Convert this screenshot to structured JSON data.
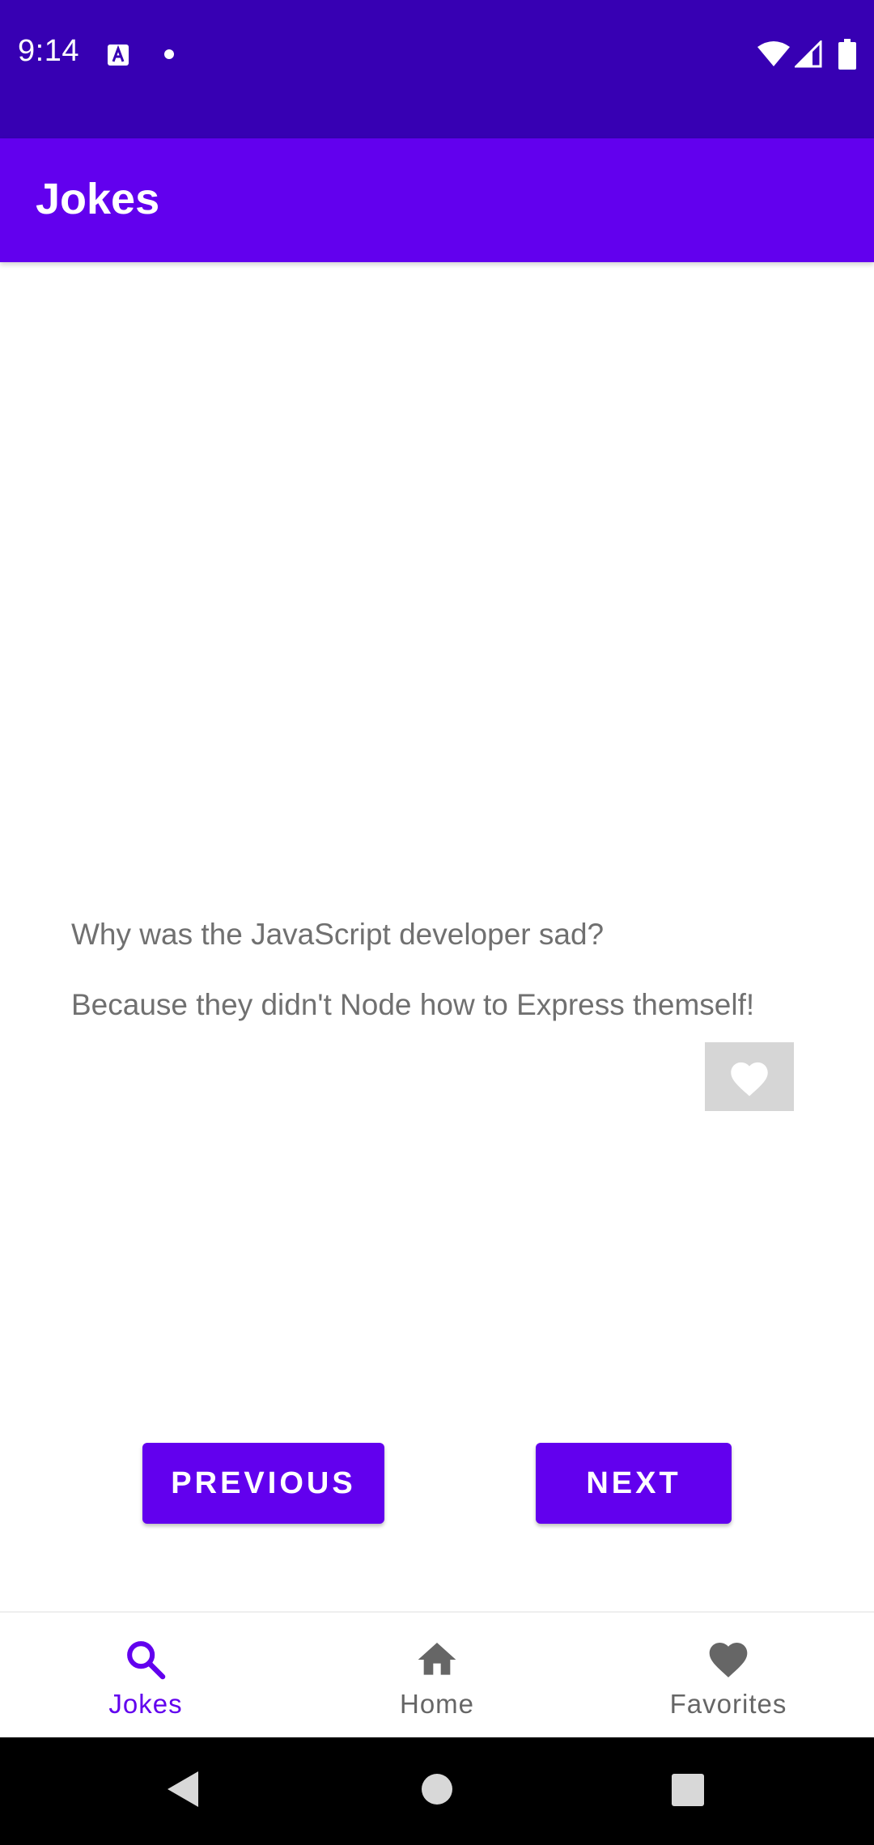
{
  "status_bar": {
    "time": "9:14",
    "icons": [
      "keyboard-a-icon",
      "dot-icon",
      "wifi-icon",
      "signal-icon",
      "battery-icon"
    ]
  },
  "app_bar": {
    "title": "Jokes"
  },
  "joke": {
    "setup": "Why was the JavaScript developer sad?",
    "punchline": "Because they didn't Node how to Express themself!",
    "favorite_icon": "heart-icon"
  },
  "buttons": {
    "previous_label": "PREVIOUS",
    "next_label": "NEXT"
  },
  "bottom_nav": {
    "items": [
      {
        "label": "Jokes",
        "icon": "search-icon",
        "active": true
      },
      {
        "label": "Home",
        "icon": "home-icon",
        "active": false
      },
      {
        "label": "Favorites",
        "icon": "heart-icon",
        "active": false
      }
    ]
  },
  "colors": {
    "status_bar": "#3700b3",
    "primary": "#6200ee",
    "text_secondary": "#707070",
    "favorite_bg": "#d6d6d6",
    "nav_inactive": "#666666"
  }
}
